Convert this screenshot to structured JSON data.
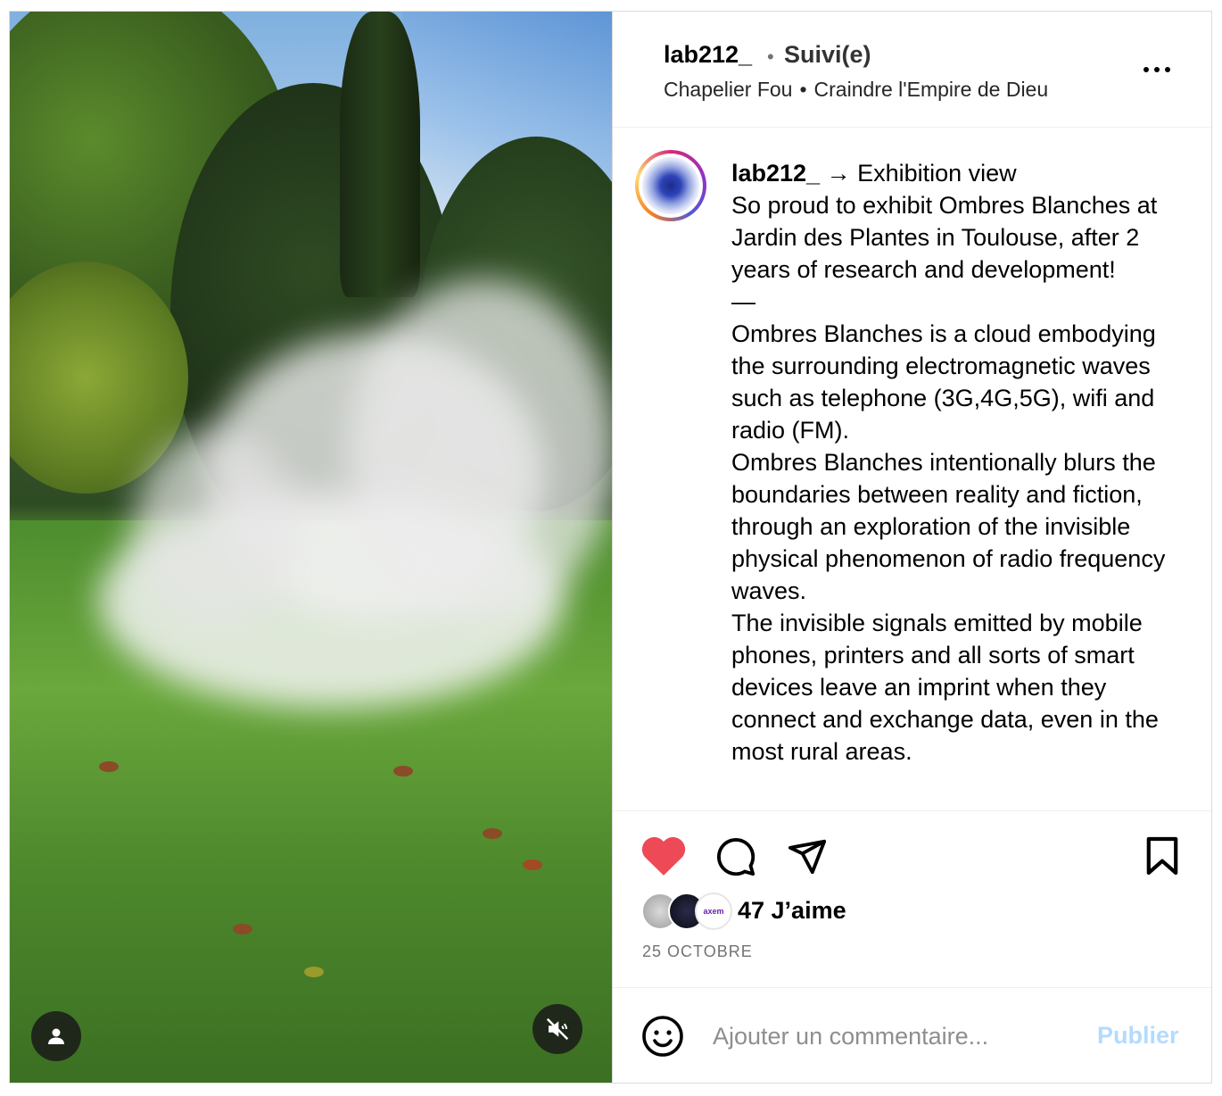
{
  "header": {
    "username": "lab212_",
    "separator": "•",
    "follow_status": "Suivi(e)",
    "music": {
      "artist": "Chapelier Fou",
      "separator": "•",
      "track": "Craindre l'Empire de Dieu"
    },
    "more_icon": "more-horizontal-icon"
  },
  "caption": {
    "username": "lab212_",
    "lines": [
      "→ Exhibition view",
      "So proud to exhibit Ombres Blanches at Jardin des Plantes in Toulouse, after 2 years of research and development!",
      "—",
      "Ombres Blanches is a cloud embodying the surrounding electromagnetic waves such as telephone (3G,4G,5G), wifi and radio (FM).",
      "Ombres Blanches intentionally blurs the boundaries between reality and fiction, through an exploration of the invisible physical phenomenon of radio frequency waves.",
      "The invisible signals emitted by mobile phones, printers and all sorts of smart devices leave an imprint when they connect and exchange data, even in the most rural areas."
    ]
  },
  "actions": {
    "like_icon": "heart-filled-icon",
    "comment_icon": "comment-icon",
    "share_icon": "send-icon",
    "save_icon": "bookmark-icon",
    "like_color": "#ed4956"
  },
  "likes": {
    "count_text": "47 J’aime",
    "liker3_label": "axem"
  },
  "date": "25 OCTOBRE",
  "comment_bar": {
    "emoji_icon": "emoji-smile-icon",
    "placeholder": "Ajouter un commentaire...",
    "publish_label": "Publier",
    "publish_color": "#b3dbff"
  },
  "media": {
    "user_icon": "user-tag-icon",
    "mute_icon": "volume-muted-icon"
  }
}
